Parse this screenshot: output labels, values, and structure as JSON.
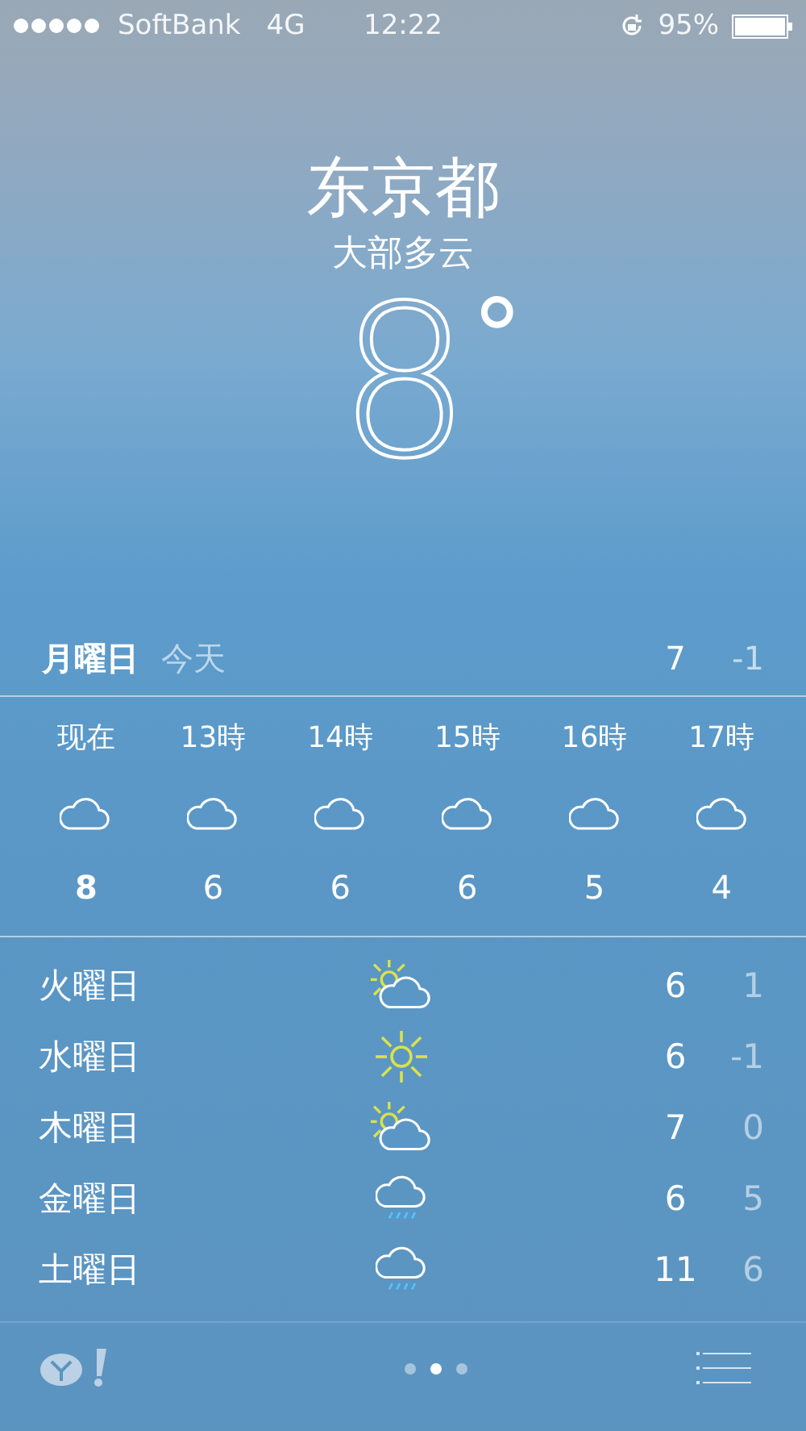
{
  "status_bar": {
    "carrier": "SoftBank",
    "network": "4G",
    "time": "12:22",
    "battery_text": "95%"
  },
  "location": {
    "city": "东京都",
    "condition": "大部多云",
    "temperature": "8",
    "degree": "°"
  },
  "today": {
    "day": "月曜日",
    "label": "今天",
    "high": "7",
    "low": "-1"
  },
  "hourly": [
    {
      "time": "现在",
      "kind": "cloud",
      "temp": "8",
      "now": true
    },
    {
      "time": "13時",
      "kind": "cloud",
      "temp": "6",
      "now": false
    },
    {
      "time": "14時",
      "kind": "cloud",
      "temp": "6",
      "now": false
    },
    {
      "time": "15時",
      "kind": "cloud",
      "temp": "6",
      "now": false
    },
    {
      "time": "16時",
      "kind": "cloud",
      "temp": "5",
      "now": false
    },
    {
      "time": "17時",
      "kind": "cloud",
      "temp": "4",
      "now": false
    }
  ],
  "daily": [
    {
      "day": "火曜日",
      "kind": "partly_sunny",
      "high": "6",
      "low": "1"
    },
    {
      "day": "水曜日",
      "kind": "sunny",
      "high": "6",
      "low": "-1"
    },
    {
      "day": "木曜日",
      "kind": "partly_sunny",
      "high": "7",
      "low": "0"
    },
    {
      "day": "金曜日",
      "kind": "rain",
      "high": "6",
      "low": "5"
    },
    {
      "day": "土曜日",
      "kind": "rain",
      "high": "11",
      "low": "6"
    }
  ],
  "pages": [
    {
      "selected": false
    },
    {
      "selected": true
    },
    {
      "selected": false
    }
  ]
}
